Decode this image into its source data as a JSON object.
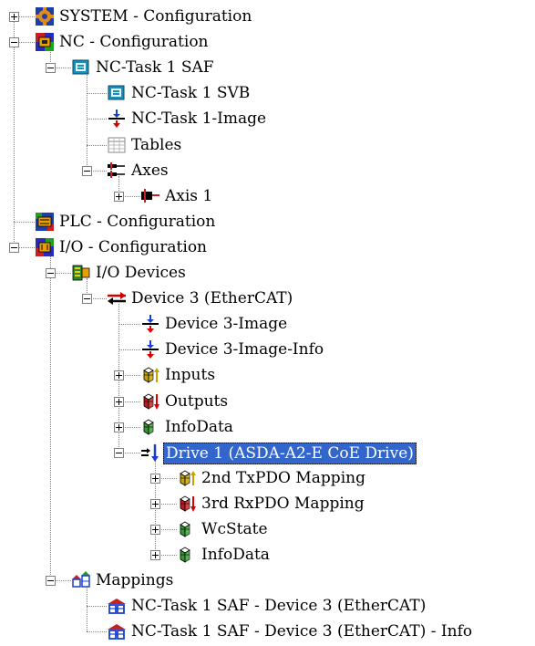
{
  "tree": {
    "items": [
      {
        "label": "SYSTEM - Configuration",
        "icon": "system-config-icon",
        "expander": "plus"
      },
      {
        "label": "NC - Configuration",
        "icon": "nc-config-icon",
        "expander": "minus"
      },
      {
        "label": "NC-Task 1 SAF",
        "icon": "task-icon",
        "expander": "minus"
      },
      {
        "label": "NC-Task 1 SVB",
        "icon": "task-icon",
        "expander": "none"
      },
      {
        "label": "NC-Task 1-Image",
        "icon": "image-icon",
        "expander": "none"
      },
      {
        "label": "Tables",
        "icon": "table-icon",
        "expander": "none"
      },
      {
        "label": "Axes",
        "icon": "axes-icon",
        "expander": "minus"
      },
      {
        "label": "Axis 1",
        "icon": "axis-icon",
        "expander": "plus"
      },
      {
        "label": "PLC - Configuration",
        "icon": "plc-config-icon",
        "expander": "none"
      },
      {
        "label": "I/O - Configuration",
        "icon": "io-config-icon",
        "expander": "minus"
      },
      {
        "label": "I/O Devices",
        "icon": "io-devices-icon",
        "expander": "minus"
      },
      {
        "label": "Device 3 (EtherCAT)",
        "icon": "ethercat-device-icon",
        "expander": "minus"
      },
      {
        "label": "Device 3-Image",
        "icon": "image-icon",
        "expander": "none"
      },
      {
        "label": "Device 3-Image-Info",
        "icon": "image-icon",
        "expander": "none"
      },
      {
        "label": "Inputs",
        "icon": "inputs-icon",
        "expander": "plus"
      },
      {
        "label": "Outputs",
        "icon": "outputs-icon",
        "expander": "plus"
      },
      {
        "label": "InfoData",
        "icon": "infodata-icon",
        "expander": "plus"
      },
      {
        "label": "Drive 1 (ASDA-A2-E CoE Drive)",
        "icon": "drive-icon",
        "expander": "minus",
        "selected": true
      },
      {
        "label": "2nd TxPDO Mapping",
        "icon": "inputs-icon",
        "expander": "plus"
      },
      {
        "label": "3rd RxPDO Mapping",
        "icon": "outputs-icon",
        "expander": "plus"
      },
      {
        "label": "WcState",
        "icon": "infodata-icon",
        "expander": "plus"
      },
      {
        "label": "InfoData",
        "icon": "infodata-icon",
        "expander": "plus"
      },
      {
        "label": "Mappings",
        "icon": "mappings-icon",
        "expander": "minus"
      },
      {
        "label": "NC-Task 1 SAF - Device 3 (EtherCAT)",
        "icon": "mapping-icon",
        "expander": "none"
      },
      {
        "label": "NC-Task 1 SAF - Device 3 (EtherCAT) - Info",
        "icon": "mapping-icon",
        "expander": "none"
      }
    ]
  },
  "colors": {
    "selection": "#3366cc",
    "tree_lines": "#808080",
    "input_arrow": "#c8a000",
    "output_arrow": "#dd0000",
    "green_cube": "#2e9a2e"
  }
}
